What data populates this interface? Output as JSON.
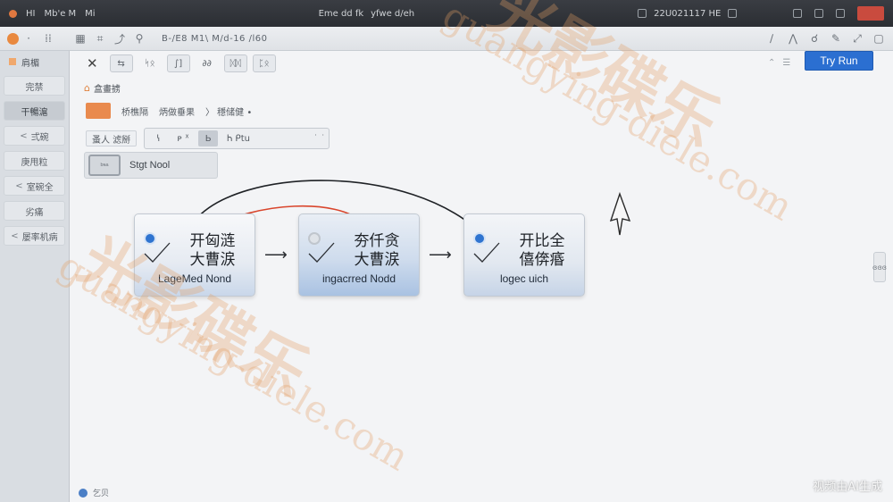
{
  "titlebar": {
    "left_items": [
      "HI",
      "Mb'e M",
      "Mi"
    ],
    "center_items": [
      "Eme dd fk",
      "yfwe d/eh"
    ],
    "right_center": "22U021117 HE"
  },
  "toolbar": {
    "path": "B-/E8 M1\\ M/d-16 /l60"
  },
  "sidebar": {
    "top_label": "肩楣",
    "items": [
      {
        "label": "完禁",
        "active": false,
        "chev": ""
      },
      {
        "label": "干暢滬",
        "active": true,
        "chev": ""
      },
      {
        "label": "弍碗",
        "active": false,
        "chev": "<"
      },
      {
        "label": "庚甩粒",
        "active": false,
        "chev": ""
      },
      {
        "label": "室碗全",
        "active": false,
        "chev": "<"
      },
      {
        "label": "劣痛",
        "active": false,
        "chev": ""
      },
      {
        "label": "屡率机病",
        "active": false,
        "chev": "<"
      }
    ],
    "footer": "乞贝"
  },
  "subbar": {
    "buttons": [
      "⇆",
      "ᛋᛟ",
      "∫]",
      "∂∂",
      "ᛞᛞ",
      "ᛈᛟ"
    ],
    "run_label": "Try Run"
  },
  "panel": {
    "breadcrumb": "盒畫掳",
    "prop_labels": [
      "桥樵隔",
      "炳做垂果",
      "〉 穩储健 •"
    ],
    "field_label": "蚤人 滤掰",
    "combo_items": [
      "ꝇ",
      "ᴩ ᕽ",
      "Ь",
      "Ꮒ ᑭtu"
    ],
    "combo_more": "˙ ˙",
    "stage_chip": "ᵇᶰᵃ",
    "stage_label": "Stgt Nool"
  },
  "nodes": [
    {
      "title": "开匈涟 大曹涙",
      "caption": "LageMed Nond",
      "badge": "blue"
    },
    {
      "title": "夯仟贪 大曹涙",
      "caption": "ingacrred Nodd",
      "badge": "grey"
    },
    {
      "title": "开比全 僖倴痻",
      "caption": "logec uich",
      "badge": "blue"
    }
  ],
  "scroll_tab": "ɞɞɞ",
  "corner_watermark": "视频由AI生成",
  "overlay_watermarks": [
    "光影碟乐",
    "guangying-diele.com"
  ],
  "colors": {
    "accent": "#2b6fd1",
    "orange": "#e98a4e",
    "link_red": "#d9452c",
    "link_dark": "#1f2226"
  }
}
